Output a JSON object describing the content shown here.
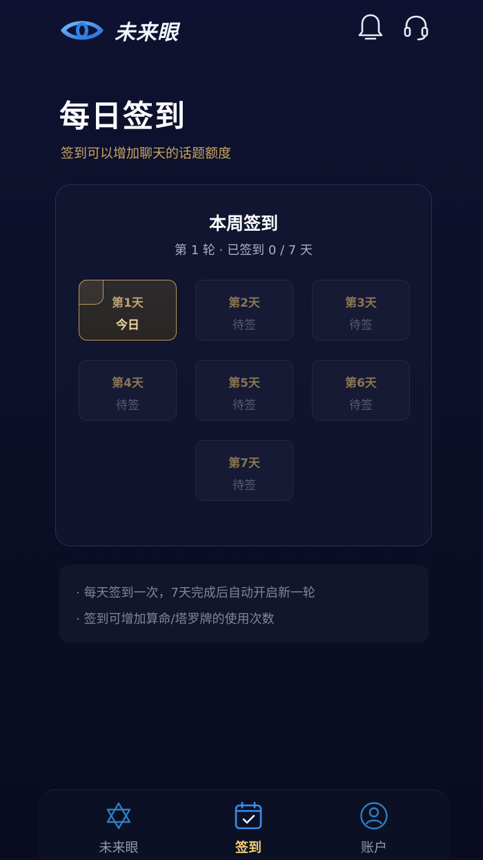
{
  "header": {
    "brand": "未来眼",
    "icons": [
      "bell-icon",
      "headset-icon"
    ]
  },
  "page": {
    "title": "每日签到",
    "subtitle": "签到可以增加聊天的话题额度"
  },
  "checkin": {
    "title": "本周签到",
    "summary": "第 1 轮 · 已签到 0 / 7 天",
    "days": [
      {
        "label": "第1天",
        "status": "今日"
      },
      {
        "label": "第2天",
        "status": "待签"
      },
      {
        "label": "第3天",
        "status": "待签"
      },
      {
        "label": "第4天",
        "status": "待签"
      },
      {
        "label": "第5天",
        "status": "待签"
      },
      {
        "label": "第6天",
        "status": "待签"
      },
      {
        "label": "第7天",
        "status": "待签"
      }
    ]
  },
  "notes": [
    "· 每天签到一次，7天完成后自动开启新一轮",
    "· 签到可增加算命/塔罗牌的使用次数"
  ],
  "tabbar": {
    "items": [
      {
        "label": "未来眼",
        "icon": "star-of-david-icon",
        "active": false
      },
      {
        "label": "签到",
        "icon": "calendar-check-icon",
        "active": true
      },
      {
        "label": "账户",
        "icon": "user-icon",
        "active": false
      }
    ]
  },
  "colors": {
    "background": "#0b0f26",
    "accent_gold": "#c9a462",
    "active_tab": "#f2cd71",
    "brand_blue": "#3d8df0"
  }
}
